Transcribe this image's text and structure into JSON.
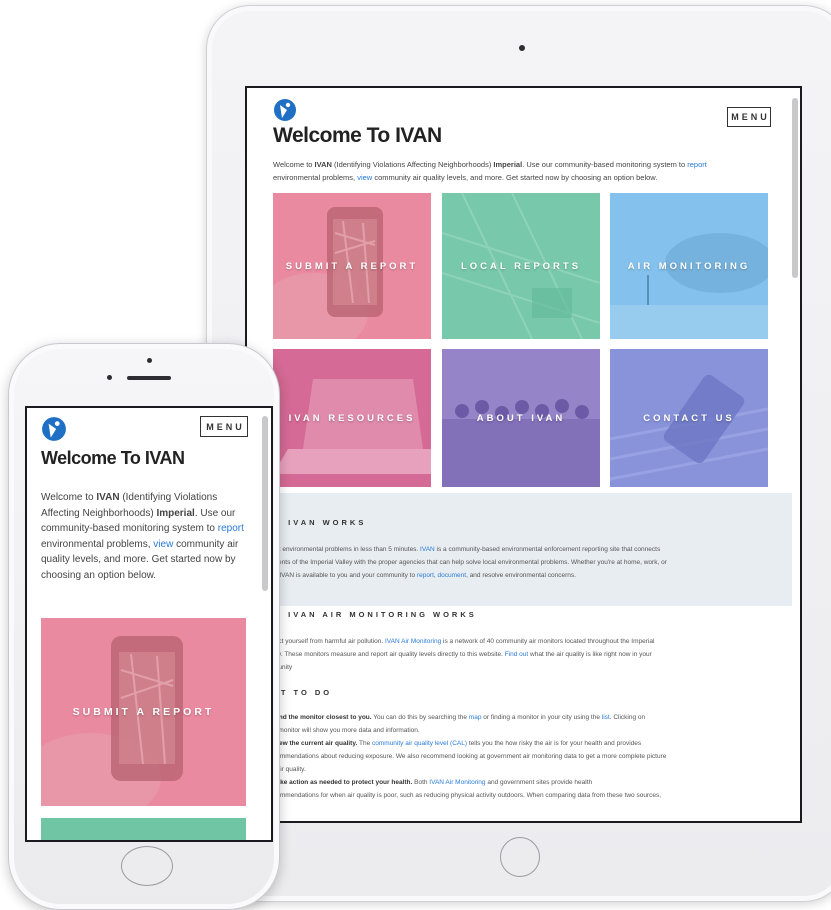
{
  "brand": {
    "name": "IVAN",
    "logo_icon": "ivan-logo-icon",
    "accent": "#2a7bd6"
  },
  "header": {
    "menu_label": "MENU",
    "title": "Welcome To IVAN"
  },
  "intro": {
    "p1": "Welcome to ",
    "bold1": "IVAN",
    "p2": " (Identifying Violations Affecting Neighborhoods) ",
    "bold2": "Imperial",
    "p3": ". Use our community-based monitoring system to ",
    "link_report": "report",
    "p4": " environmental problems, ",
    "link_view": "view",
    "p5": " community air quality levels, and more. Get started now by choosing an option below."
  },
  "tiles": [
    {
      "label": "SUBMIT A REPORT",
      "color": "#e3738b"
    },
    {
      "label": "LOCAL REPORTS",
      "color": "#6fc5a4"
    },
    {
      "label": "AIR MONITORING",
      "color": "#79b8e8"
    },
    {
      "label": "IVAN RESOURCES",
      "color": "#cf5d8a"
    },
    {
      "label": "ABOUT IVAN",
      "color": "#8a77c2"
    },
    {
      "label": "CONTACT US",
      "color": "#7e8ad6"
    }
  ],
  "how_it_works": {
    "heading": "W IVAN WORKS",
    "s1": "ort environmental problems in less than 5 minutes. ",
    "l1": "IVAN",
    "s2": " is a community-based environmental enforcement reporting site that connects",
    "line2": "idents of the Imperial Valley with the proper agencies that can help solve local environmental problems. Whether you're at home, work, or",
    "s3": "y, IVAN is available to you and your community to ",
    "l2": "report",
    "s4": ", ",
    "l3": "document",
    "s5": ", and resolve environmental concerns."
  },
  "air_monitoring": {
    "heading": "W IVAN AIR MONITORING WORKS",
    "s1": "tect yourself from harmful air pollution. ",
    "l1": "IVAN Air Monitoring",
    "s2": " is a network of 40 community air monitors located throughout the Imperial",
    "s3": "ley. These monitors measure and report air quality levels directly to this website. ",
    "l2": "Find out",
    "s4": " what the air quality is like right now in your",
    "line3": "munity"
  },
  "what_to_do": {
    "heading": "AT TO DO",
    "i1_bold": "Find the monitor closest to you.",
    "i1_a": " You can do this by searching the ",
    "i1_l1": "map",
    "i1_b": " or finding a monitor in your city using the ",
    "i1_l2": "list",
    "i1_c": ". Clicking on",
    "i1_line2": "e monitor will show you more data and information.",
    "i2_bold": "View the current air quality.",
    "i2_a": " The ",
    "i2_l1": "community air quality level (CAL)",
    "i2_b": " tells you the how risky the air is for your health and provides",
    "i2_line2": "commendations about reducing exposure. We also recommend looking at government air monitoring data to get a more complete picture",
    "i2_line3": "f air quality.",
    "i3_bold": "Take action as needed to protect your health.",
    "i3_a": " Both ",
    "i3_l1": "IVAN Air Monitoring",
    "i3_b": " and government sites provide health",
    "i3_line2": "commendations for when air quality is poor, such as reducing physical activity outdoors. When comparing data from these two sources,"
  }
}
